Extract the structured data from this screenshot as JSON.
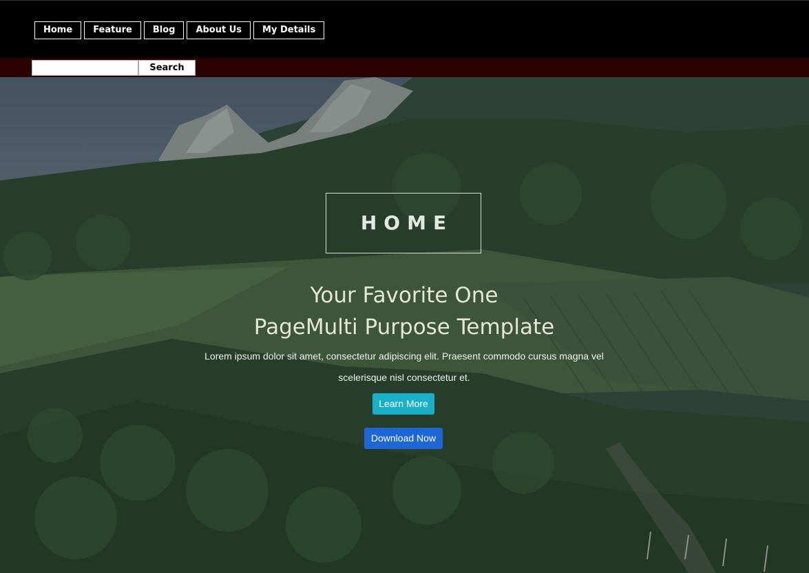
{
  "nav": {
    "items": [
      {
        "label": "Home"
      },
      {
        "label": "Feature"
      },
      {
        "label": "Blog"
      },
      {
        "label": "About Us"
      },
      {
        "label": "My Details"
      }
    ]
  },
  "search": {
    "value": "",
    "button_label": "Search"
  },
  "hero": {
    "badge": "HOME",
    "title_line1": "Your Favorite One",
    "title_line2": "PageMulti Purpose Template",
    "text": "Lorem ipsum dolor sit amet, consectetur adipiscing elit. Praesent commodo cursus magna vel scelerisque nisl consectetur et.",
    "learn_more_label": "Learn More",
    "download_label": "Download Now"
  },
  "colors": {
    "topbar": "#000000",
    "searchbar": "#2a0202",
    "learn_button": "#1ab0c9",
    "download_button": "#1d66d6"
  }
}
